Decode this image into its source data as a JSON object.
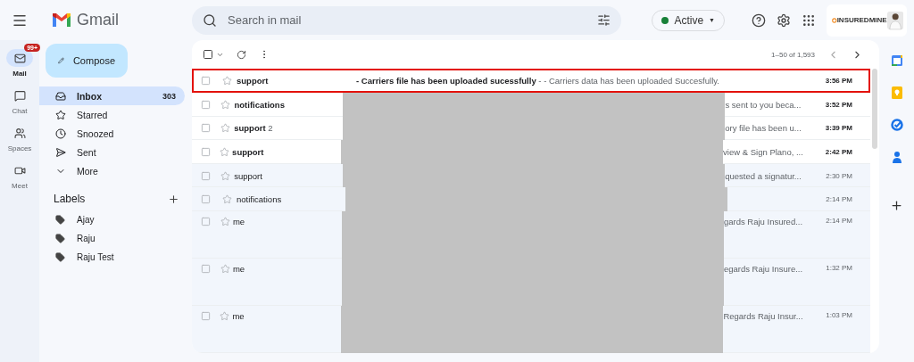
{
  "app": {
    "name": "Gmail"
  },
  "search": {
    "placeholder": "Search in mail"
  },
  "status": {
    "label": "Active",
    "caret": "▼",
    "color": "#188038"
  },
  "account": {
    "logo_text": "INSUREDMINE"
  },
  "rail": [
    {
      "label": "Mail",
      "selected": true,
      "badge": "99+"
    },
    {
      "label": "Chat",
      "selected": false
    },
    {
      "label": "Spaces",
      "selected": false
    },
    {
      "label": "Meet",
      "selected": false
    }
  ],
  "compose": {
    "label": "Compose"
  },
  "folders": [
    {
      "label": "Inbox",
      "count": "303",
      "selected": true
    },
    {
      "label": "Starred",
      "selected": false
    },
    {
      "label": "Snoozed",
      "selected": false
    },
    {
      "label": "Sent",
      "selected": false
    },
    {
      "label": "More",
      "selected": false
    }
  ],
  "labels": {
    "title": "Labels",
    "items": [
      {
        "label": "Ajay"
      },
      {
        "label": "Raju"
      },
      {
        "label": "Raju Test"
      }
    ]
  },
  "toolbar": {
    "range": "1–50 of 1,593",
    "select_all_checked": false
  },
  "messages": [
    {
      "sender": "support",
      "subject": "- Carriers file has been uploaded sucessfully",
      "snippet": " - - Carriers data has been uploaded Succesfully.",
      "time": "3:56 PM",
      "unread": true,
      "outlined": true,
      "covered": false,
      "tall": false,
      "checked": false,
      "starred": false
    },
    {
      "sender": "notifications",
      "snippet": "s sent to you beca...",
      "time": "3:52 PM",
      "unread": true,
      "outlined": false,
      "covered": true,
      "tall": false,
      "checked": false,
      "starred": false
    },
    {
      "sender": "support",
      "count": "2",
      "snippet": "ory file has been u...",
      "time": "3:39 PM",
      "unread": true,
      "outlined": false,
      "covered": true,
      "tall": false,
      "checked": false,
      "starred": false
    },
    {
      "sender": "support",
      "snippet": "view & Sign Plano, ...",
      "time": "2:42 PM",
      "unread": true,
      "outlined": false,
      "covered": true,
      "tall": false,
      "checked": false,
      "starred": false
    },
    {
      "sender": "support",
      "snippet": "quested a signatur...",
      "time": "2:30 PM",
      "unread": false,
      "outlined": false,
      "covered": true,
      "tall": false,
      "checked": false,
      "starred": false
    },
    {
      "sender": "notifications",
      "time": "2:14 PM",
      "unread": false,
      "outlined": false,
      "covered": true,
      "tall": false,
      "checked": false,
      "starred": false
    },
    {
      "sender": "me",
      "snippet": "gards Raju Insured...",
      "time": "2:14 PM",
      "unread": false,
      "outlined": false,
      "covered": true,
      "tall": true,
      "checked": false,
      "starred": false
    },
    {
      "sender": "me",
      "snippet": "egards Raju Insure...",
      "time": "1:32 PM",
      "unread": false,
      "outlined": false,
      "covered": true,
      "tall": true,
      "checked": false,
      "starred": false
    },
    {
      "sender": "me",
      "snippet": "Regards Raju Insur...",
      "time": "1:03 PM",
      "unread": false,
      "outlined": false,
      "covered": true,
      "tall": true,
      "checked": false,
      "starred": false
    }
  ]
}
